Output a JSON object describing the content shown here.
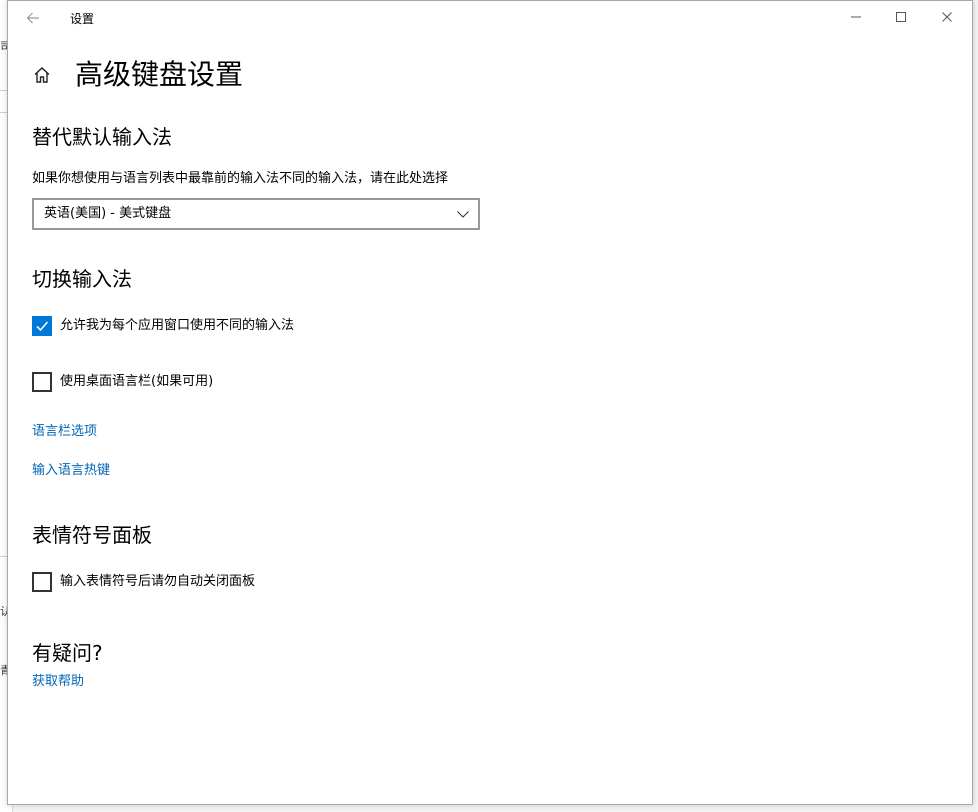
{
  "behind_window": {
    "fragments": [
      "司",
      "认",
      "青"
    ]
  },
  "window": {
    "title": "设置",
    "controls": {
      "back_icon": "arrow-left-icon",
      "minimize_icon": "minimize-icon",
      "maximize_icon": "maximize-icon",
      "close_icon": "close-icon"
    }
  },
  "page": {
    "home_icon": "home-icon",
    "title": "高级键盘设置"
  },
  "override_section": {
    "title": "替代默认输入法",
    "description": "如果你想使用与语言列表中最靠前的输入法不同的输入法，请在此处选择",
    "selected_value": "英语(美国) - 美式键盘"
  },
  "switch_section": {
    "title": "切换输入法",
    "checkboxes": [
      {
        "label": "允许我为每个应用窗口使用不同的输入法",
        "checked": true
      },
      {
        "label": "使用桌面语言栏(如果可用)",
        "checked": false
      }
    ],
    "links": [
      "语言栏选项",
      "输入语言热键"
    ]
  },
  "emoji_section": {
    "title": "表情符号面板",
    "checkbox": {
      "label": "输入表情符号后请勿自动关闭面板",
      "checked": false
    }
  },
  "help_section": {
    "title": "有疑问?",
    "link": "获取帮助"
  },
  "colors": {
    "accent": "#0078d7",
    "link": "#0067b8",
    "border": "#999999"
  }
}
